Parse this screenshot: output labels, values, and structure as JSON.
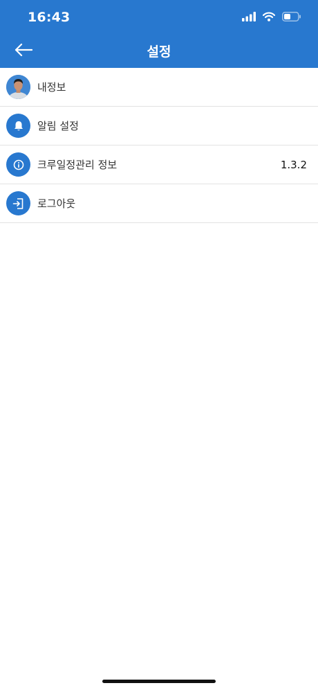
{
  "status_bar": {
    "time": "16:43",
    "icons": [
      "signal-icon",
      "wifi-icon",
      "battery-icon"
    ]
  },
  "nav": {
    "title": "설정",
    "back_icon": "arrow-left-icon"
  },
  "settings": {
    "items": [
      {
        "label": "내정보",
        "icon": "avatar"
      },
      {
        "label": "알림 설정",
        "icon": "bell-icon"
      },
      {
        "label": "크루일정관리 정보",
        "icon": "info-icon",
        "value": "1.3.2"
      },
      {
        "label": "로그아웃",
        "icon": "logout-icon"
      }
    ]
  },
  "colors": {
    "accent": "#2878cf",
    "divider": "#e2e2e2",
    "text": "#333333"
  }
}
